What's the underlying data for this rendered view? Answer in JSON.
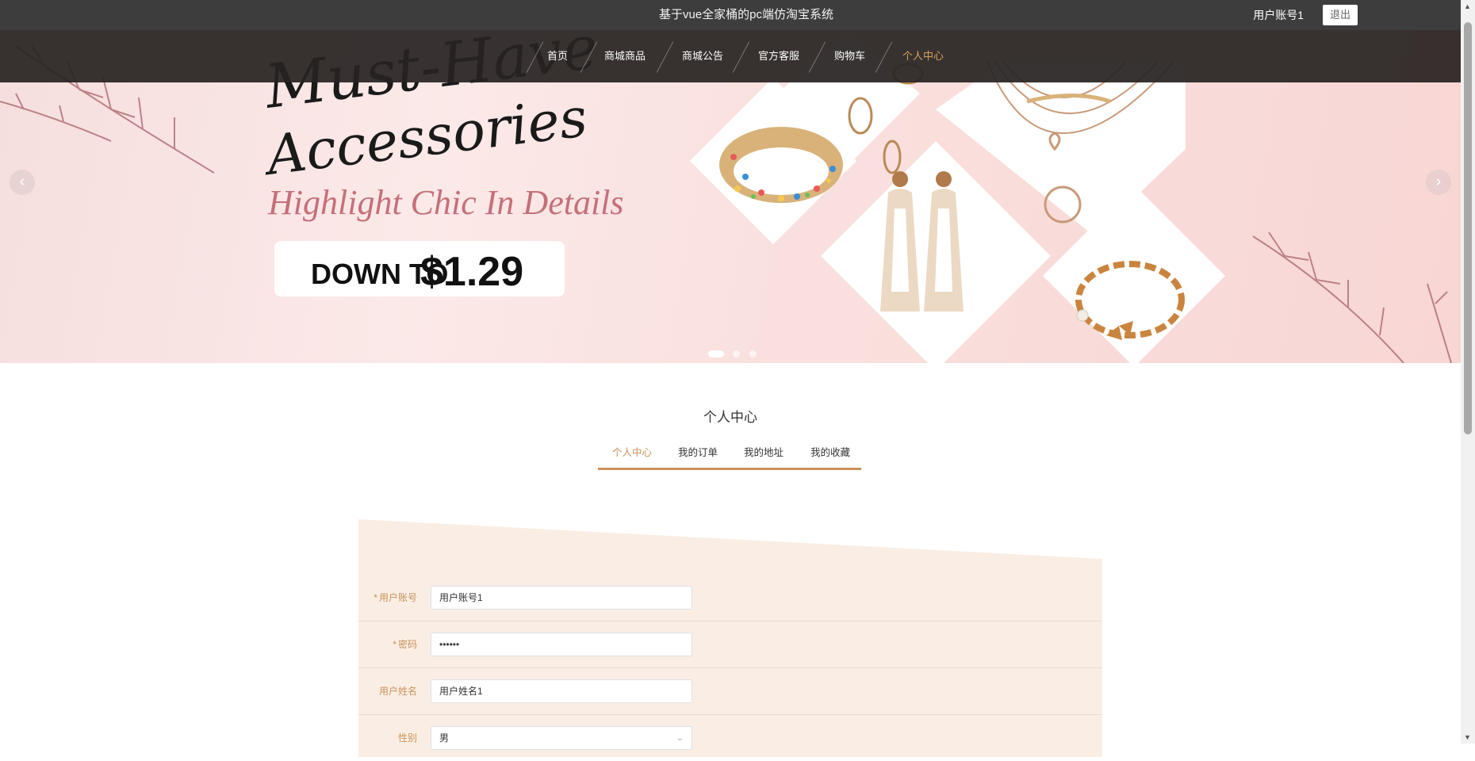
{
  "header": {
    "title": "基于vue全家桶的pc端仿淘宝系统",
    "username": "用户账号1",
    "logout_label": "退出"
  },
  "nav": {
    "items": [
      {
        "label": "首页"
      },
      {
        "label": "商城商品"
      },
      {
        "label": "商城公告"
      },
      {
        "label": "官方客服"
      },
      {
        "label": "购物车"
      },
      {
        "label": "个人中心"
      }
    ],
    "active_index": 5
  },
  "banner": {
    "headline_1": "Must-Have",
    "headline_2": "Accessories",
    "subline": "Highlight Chic In Details",
    "promo_prefix": "DOWN TO",
    "promo_price": "$1.29",
    "prev_arrow": "‹",
    "next_arrow": "›",
    "slide_count": 3,
    "active_slide": 1
  },
  "section": {
    "title": "个人中心",
    "tabs": [
      {
        "label": "个人中心"
      },
      {
        "label": "我的订单"
      },
      {
        "label": "我的地址"
      },
      {
        "label": "我的收藏"
      }
    ],
    "active_tab": 0
  },
  "form": {
    "fields": [
      {
        "label": "用户账号",
        "required": true,
        "value": "用户账号1"
      },
      {
        "label": "密码",
        "required": true,
        "value": "••••••"
      },
      {
        "label": "用户姓名",
        "required": false,
        "value": "用户姓名1"
      },
      {
        "label": "性别",
        "required": false,
        "value": "男"
      }
    ],
    "required_mark": "*"
  },
  "colors": {
    "accent": "#c9925a",
    "topbar": "#3d3d3d",
    "form_bg": "#faeee4",
    "banner_pink": "#f8dcdb"
  },
  "icons": {
    "select": "chevron-down-icon",
    "scroll_up": "scroll-up-icon",
    "scroll_down": "scroll-down-icon"
  }
}
